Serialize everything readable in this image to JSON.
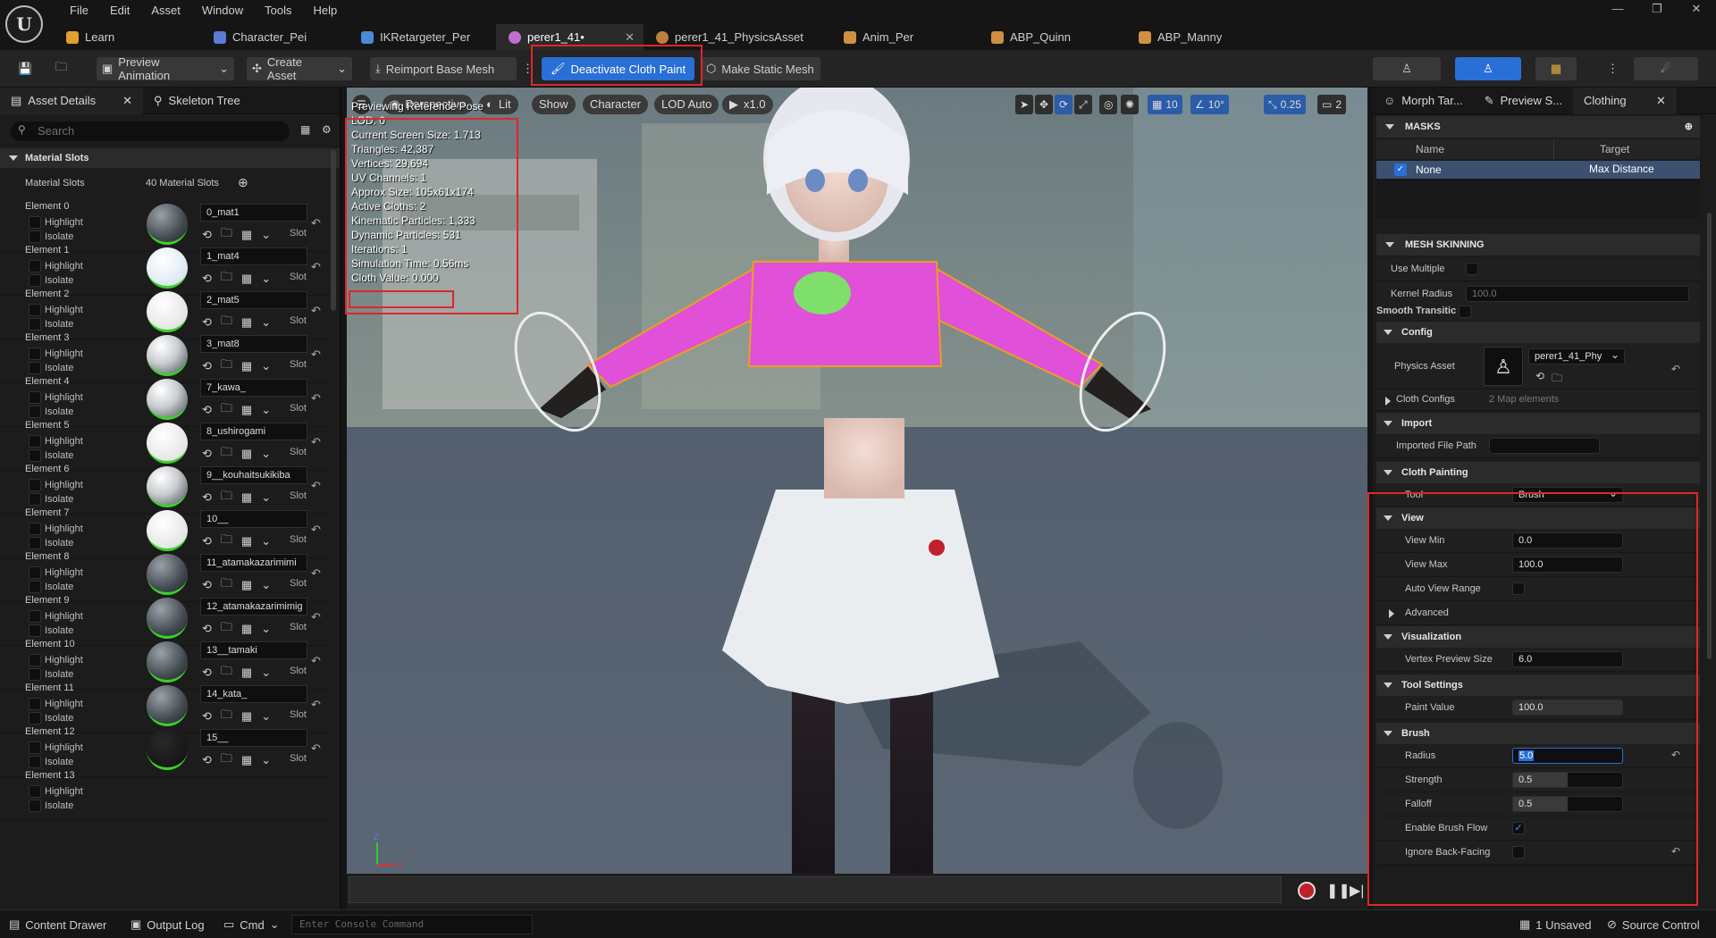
{
  "app": {
    "menu": [
      "File",
      "Edit",
      "Asset",
      "Window",
      "Tools",
      "Help"
    ],
    "tabs": [
      {
        "label": "Learn",
        "color": "#e0a030"
      },
      {
        "label": "Character_Pei",
        "color": "#5a7bd8"
      },
      {
        "label": "IKRetargeter_Per",
        "color": "#4a8ad8"
      },
      {
        "label": "perer1_41•",
        "color": "#c070d0"
      },
      {
        "label": "perer1_41_PhysicsAsset",
        "color": "#c0803a"
      },
      {
        "label": "Anim_Per",
        "color": "#d09040"
      },
      {
        "label": "ABP_Quinn",
        "color": "#d09040"
      },
      {
        "label": "ABP_Manny",
        "color": "#d09040"
      }
    ]
  },
  "toolbar": {
    "preview_animation": "Preview Animation",
    "create_asset": "Create Asset",
    "reimport": "Reimport Base Mesh",
    "deactivate": "Deactivate Cloth Paint",
    "make_static": "Make Static Mesh"
  },
  "left": {
    "tab_asset_details": "Asset Details",
    "tab_skeleton_tree": "Skeleton Tree",
    "search_placeholder": "Search",
    "section": "Material Slots",
    "slots_label": "Material Slots",
    "slots_count": "40 Material Slots",
    "highlight": "Highlight",
    "isolate": "Isolate",
    "slot": "Slot",
    "elements": [
      {
        "name": "Element 0",
        "mat": "0_mat1",
        "ball": "dark"
      },
      {
        "name": "Element 1",
        "mat": "1_mat4",
        "ball": "light"
      },
      {
        "name": "Element 2",
        "mat": "2_mat5",
        "ball": "white"
      },
      {
        "name": "Element 3",
        "mat": "3_mat8",
        "ball": "mixed"
      },
      {
        "name": "Element 4",
        "mat": "7_kawa_",
        "ball": "mixed"
      },
      {
        "name": "Element 5",
        "mat": "8_ushirogami",
        "ball": "white"
      },
      {
        "name": "Element 6",
        "mat": "9__kouhaitsukikiba",
        "ball": "mixed"
      },
      {
        "name": "Element 7",
        "mat": "10__",
        "ball": "white"
      },
      {
        "name": "Element 8",
        "mat": "11_atamakazarimimi",
        "ball": "dark"
      },
      {
        "name": "Element 9",
        "mat": "12_atamakazarimimig",
        "ball": "dark"
      },
      {
        "name": "Element 10",
        "mat": "13__tamaki",
        "ball": "dark"
      },
      {
        "name": "Element 11",
        "mat": "14_kata_",
        "ball": "dark"
      },
      {
        "name": "Element 12",
        "mat": "15__",
        "ball": "black"
      },
      {
        "name": "Element 13",
        "mat": "",
        "ball": "none"
      }
    ]
  },
  "viewport": {
    "perspective": "Perspective",
    "lit": "Lit",
    "show": "Show",
    "character": "Character",
    "lod": "LOD Auto",
    "speed": "x1.0",
    "grid": "10",
    "angle": "10°",
    "scale": "0.25",
    "cam": "2",
    "stats": [
      "Previewing Reference Pose",
      "LOD: 0",
      "Current Screen Size: 1.713",
      "Triangles: 42,387",
      "Vertices: 29,694",
      "UV Channels: 1",
      "Approx Size: 105x61x174",
      "Active Cloths: 2",
      "Kinematic Particles: 1,333",
      "Dynamic Particles: 531",
      "Iterations: 1",
      "Simulation Time: 0.56ms",
      "Cloth Value: 0.000"
    ]
  },
  "right": {
    "tab_morph": "Morph Tar...",
    "tab_preview": "Preview S...",
    "tab_clothing": "Clothing",
    "masks": "MASKS",
    "col_name": "Name",
    "col_target": "Target",
    "mask_name": "None",
    "mask_target": "Max Distance",
    "mesh_skinning": "MESH SKINNING",
    "use_multiple": "Use Multiple",
    "kernel_radius": "Kernel Radius",
    "kernel_value": "100.0",
    "smooth": "Smooth Transitic",
    "config": "Config",
    "physics_asset": "Physics Asset",
    "physics_value": "perer1_41_Phy",
    "cloth_configs": "Cloth Configs",
    "cloth_configs_value": "2 Map elements",
    "import": "Import",
    "imported_file_path": "Imported File Path",
    "cloth_painting": "Cloth Painting",
    "tool": "Tool",
    "tool_value": "Brush",
    "view": "View",
    "view_min": "View Min",
    "view_min_value": "0.0",
    "view_max": "View Max",
    "view_max_value": "100.0",
    "auto_view_range": "Auto View Range",
    "advanced": "Advanced",
    "visualization": "Visualization",
    "vertex_preview_size": "Vertex Preview Size",
    "vertex_preview_value": "6.0",
    "tool_settings": "Tool Settings",
    "paint_value": "Paint Value",
    "paint_value_value": "100.0",
    "brush": "Brush",
    "radius": "Radius",
    "radius_value": "5.0",
    "strength": "Strength",
    "strength_value": "0.5",
    "falloff": "Falloff",
    "falloff_value": "0.5",
    "enable_brush_flow": "Enable Brush Flow",
    "ignore_back_facing": "Ignore Back-Facing"
  },
  "status": {
    "content_drawer": "Content Drawer",
    "output_log": "Output Log",
    "cmd": "Cmd",
    "console_placeholder": "Enter Console Command",
    "unsaved": "1 Unsaved",
    "source_control": "Source Control"
  }
}
